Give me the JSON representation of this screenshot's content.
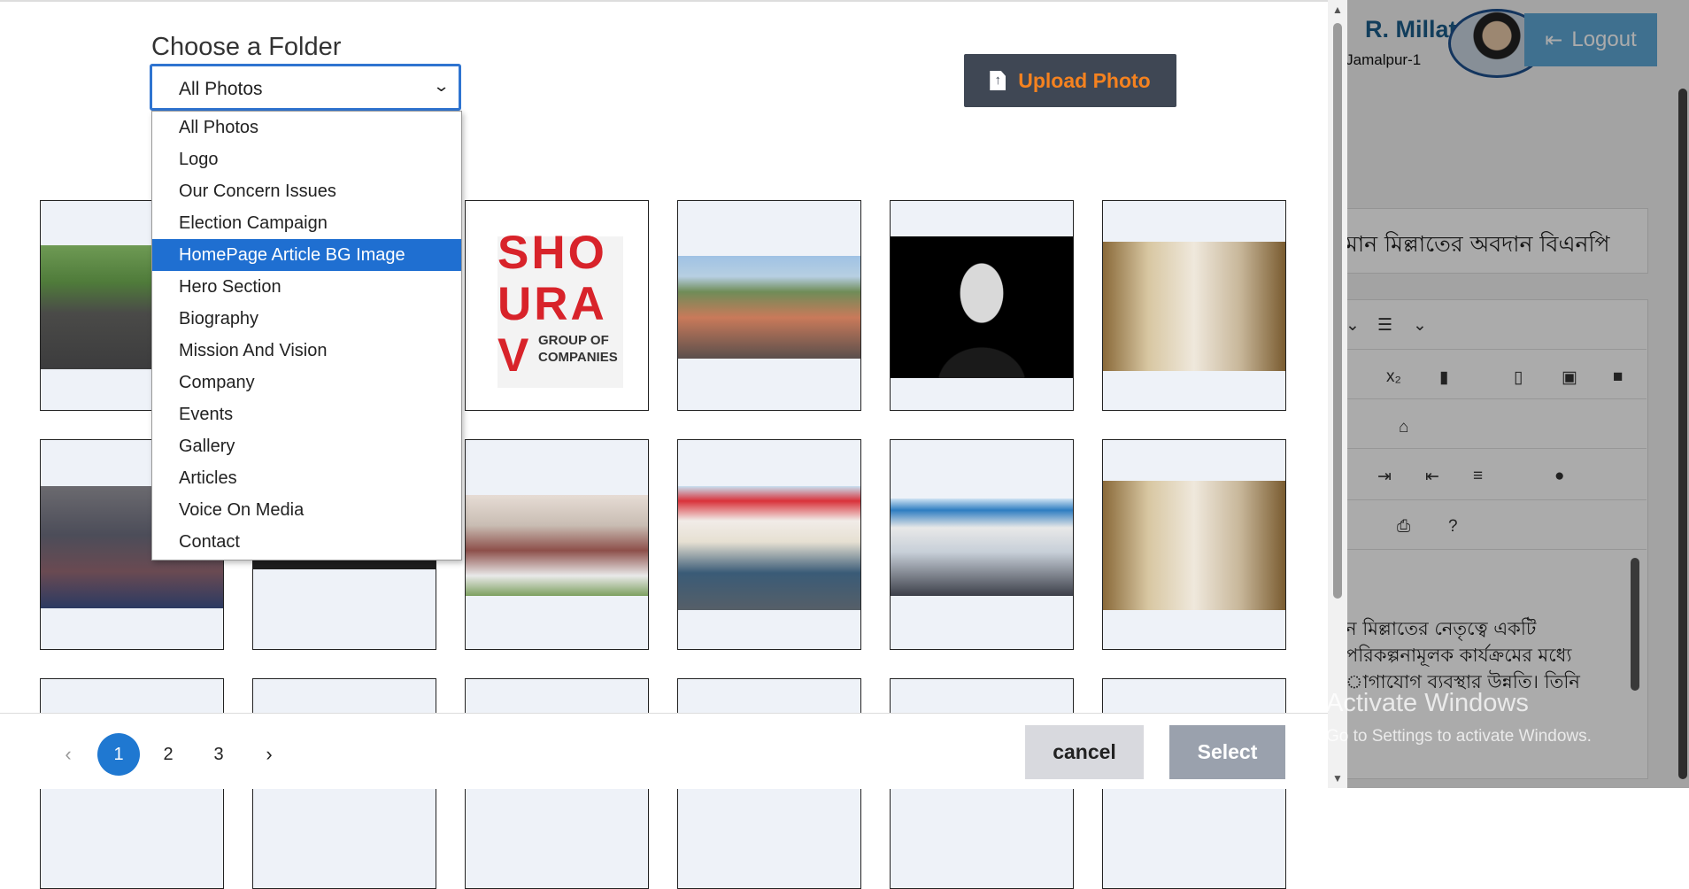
{
  "background_app": {
    "user_name": "R. Millat",
    "user_subtitle": "o Jamalpur-1",
    "logout_label": "Logout",
    "article_title": "মান মিল্লাতের অবদান বিএনপি",
    "editor_text": [
      "ন মিল্লাতের নেতৃত্বে একটি",
      "পরিকল্পনামূলক কার্যক্রমের মধ্যে",
      "াগাযোগ ব্যবস্থার উন্নতি। তিনি"
    ],
    "activate_windows": "Activate Windows",
    "activate_hint": "Go to Settings to activate Windows."
  },
  "modal": {
    "title": "Choose a Folder",
    "folder_select": {
      "selected": "All Photos",
      "highlighted": "HomePage Article BG Image",
      "options": [
        "All Photos",
        "Logo",
        "Our Concern Issues",
        "Election Campaign",
        "HomePage Article BG Image",
        "Hero Section",
        "Biography",
        "Mission And Vision",
        "Company",
        "Events",
        "Gallery",
        "Articles",
        "Voice On Media",
        "Contact"
      ]
    },
    "upload_button": "Upload Photo",
    "company_logo": {
      "letters": [
        "SHO",
        "URA",
        "V"
      ],
      "tagline": [
        "GROUP OF",
        "COMPANIES"
      ]
    },
    "pagination": {
      "pages": [
        "1",
        "2",
        "3"
      ],
      "current": "1",
      "prev_icon": "‹",
      "next_icon": "›"
    },
    "cancel_button": "cancel",
    "select_button": "Select"
  },
  "colors": {
    "accent": "#1f78d1",
    "upload_text": "#f5821f",
    "upload_bg": "#3f4754"
  }
}
